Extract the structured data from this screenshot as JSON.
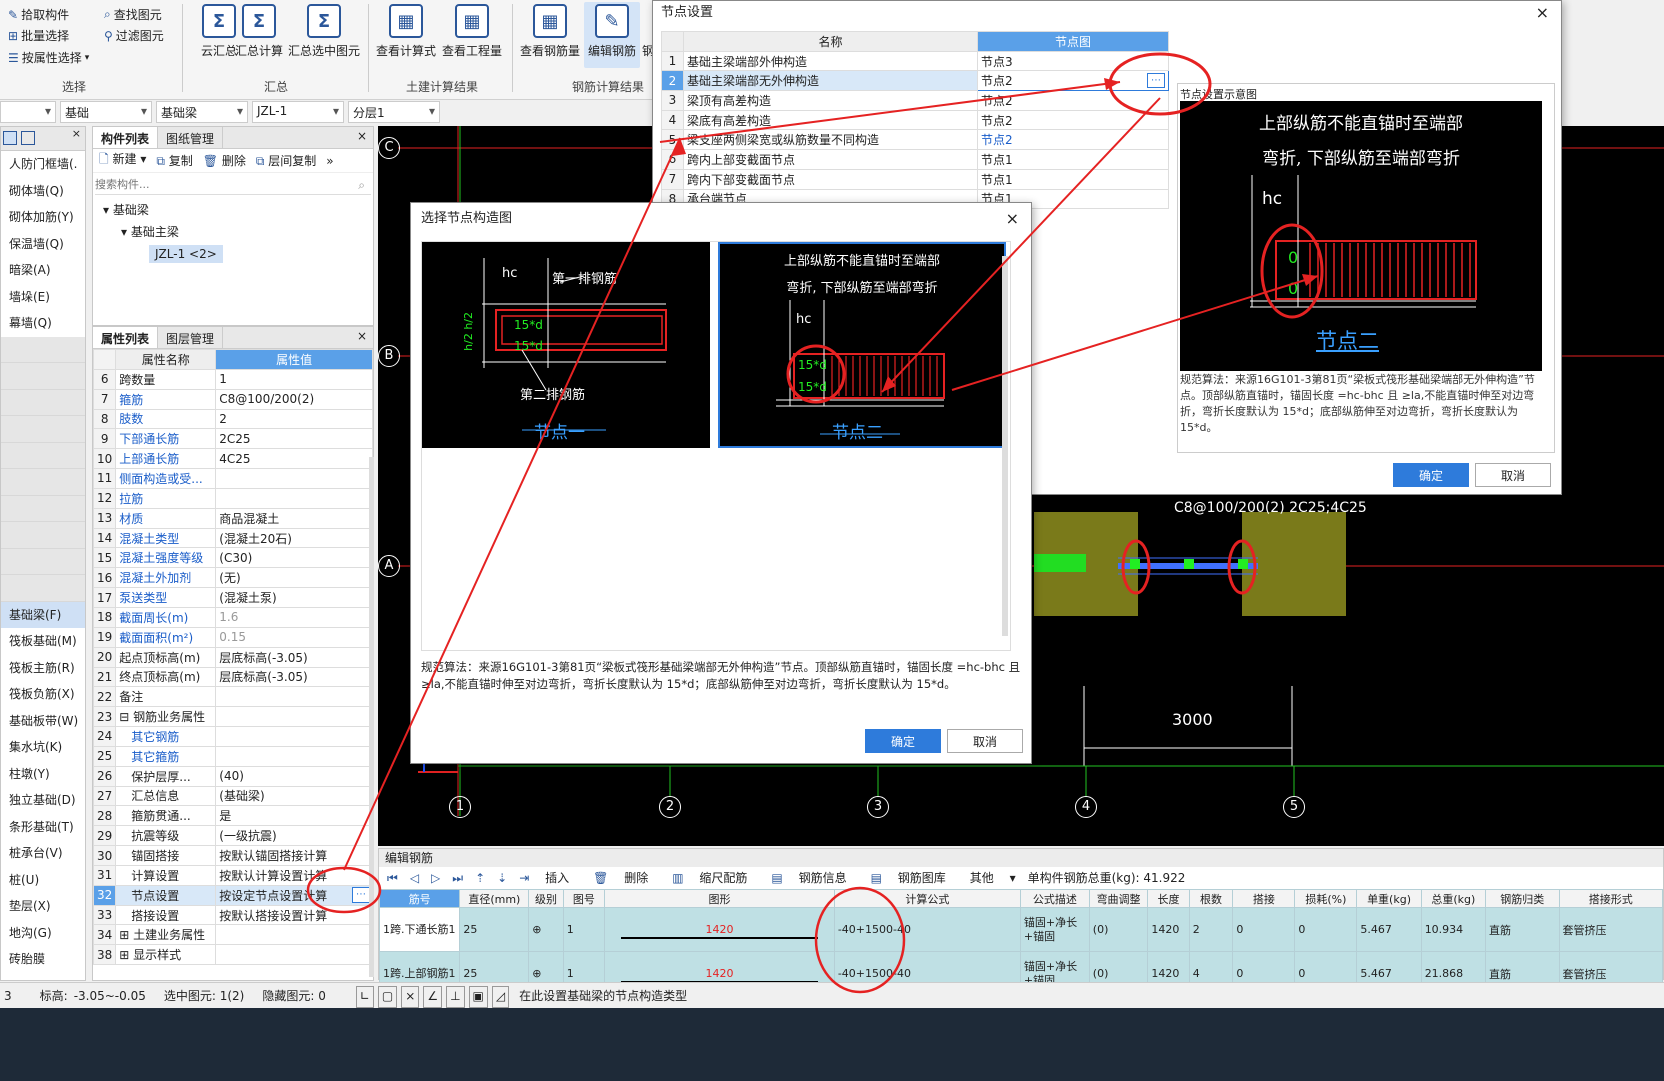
{
  "ribbon": {
    "select_group": {
      "pick": "拾取构件",
      "batch": "批量选择",
      "by_attr": "按属性选择",
      "find": "查找图元",
      "filter": "过滤图元",
      "label": "选择"
    },
    "summary_group": {
      "cloud": "云汇总",
      "calc": "汇总计算",
      "calc_sel": "汇总选中图元",
      "label": "汇总"
    },
    "civil_group": {
      "view_formula": "查看计算式",
      "view_qty": "查看工程量",
      "label": "土建计算结果"
    },
    "rebar_group": {
      "view_rebar": "查看钢筋量",
      "edit_rebar": "编辑钢筋",
      "extra": "钢",
      "label": "钢筋计算结果"
    }
  },
  "selectors": {
    "s0": "",
    "s1": "基础",
    "s2": "基础梁",
    "s3": "JZL-1",
    "s4": "分层1"
  },
  "left_nav": [
    "人防门框墙(.",
    "砌体墙(Q)",
    "砌体加筋(Y)",
    "保温墙(Q)",
    "暗梁(A)",
    "墙垛(E)",
    "幕墙(Q)",
    "",
    "",
    "",
    "",
    "",
    "",
    "",
    "",
    "",
    "",
    "基础梁(F)",
    "筏板基础(M)",
    "筏板主筋(R)",
    "筏板负筋(X)",
    "基础板带(W)",
    "集水坑(K)",
    "柱墩(Y)",
    "独立基础(D)",
    "条形基础(T)",
    "桩承台(V)",
    "桩(U)",
    "垫层(X)",
    "地沟(G)",
    "砖胎膜"
  ],
  "component_panel": {
    "tab1": "构件列表",
    "tab2": "图纸管理",
    "new": "新建",
    "copy": "复制",
    "delete": "删除",
    "floor_copy": "层间复制",
    "search_placeholder": "搜索构件...",
    "tree_root": "基础梁",
    "tree_child": "基础主梁",
    "tree_leaf": "JZL-1 <2>"
  },
  "property_panel": {
    "tab1": "属性列表",
    "tab2": "图层管理",
    "col_name": "属性名称",
    "col_value": "属性值",
    "rows": [
      {
        "n": "6",
        "name": "跨数量",
        "val": "1",
        "blue": false,
        "gray": false
      },
      {
        "n": "7",
        "name": "箍筋",
        "val": "C8@100/200(2)",
        "blue": true,
        "gray": false
      },
      {
        "n": "8",
        "name": "肢数",
        "val": "2",
        "blue": true,
        "gray": false
      },
      {
        "n": "9",
        "name": "下部通长筋",
        "val": "2C25",
        "blue": true,
        "gray": false
      },
      {
        "n": "10",
        "name": "上部通长筋",
        "val": "4C25",
        "blue": true,
        "gray": false
      },
      {
        "n": "11",
        "name": "侧面构造或受...",
        "val": "",
        "blue": true,
        "gray": false
      },
      {
        "n": "12",
        "name": "拉筋",
        "val": "",
        "blue": true,
        "gray": false
      },
      {
        "n": "13",
        "name": "材质",
        "val": "商品混凝土",
        "blue": true,
        "gray": false
      },
      {
        "n": "14",
        "name": "混凝土类型",
        "val": "(混凝土20石)",
        "blue": true,
        "gray": false
      },
      {
        "n": "15",
        "name": "混凝土强度等级",
        "val": "(C30)",
        "blue": true,
        "gray": false
      },
      {
        "n": "16",
        "name": "混凝土外加剂",
        "val": "(无)",
        "blue": true,
        "gray": false
      },
      {
        "n": "17",
        "name": "泵送类型",
        "val": "(混凝土泵)",
        "blue": true,
        "gray": false
      },
      {
        "n": "18",
        "name": "截面周长(m)",
        "val": "1.6",
        "blue": true,
        "gray": true
      },
      {
        "n": "19",
        "name": "截面面积(m²)",
        "val": "0.15",
        "blue": true,
        "gray": true
      },
      {
        "n": "20",
        "name": "起点顶标高(m)",
        "val": "层底标高(-3.05)",
        "blue": false,
        "gray": false
      },
      {
        "n": "21",
        "name": "终点顶标高(m)",
        "val": "层底标高(-3.05)",
        "blue": false,
        "gray": false
      },
      {
        "n": "22",
        "name": "备注",
        "val": "",
        "blue": false,
        "gray": false
      },
      {
        "n": "23",
        "name": "⊟ 钢筋业务属性",
        "val": "",
        "blue": false,
        "gray": false
      },
      {
        "n": "24",
        "name": "　其它钢筋",
        "val": "",
        "blue": true,
        "gray": false
      },
      {
        "n": "25",
        "name": "　其它箍筋",
        "val": "",
        "blue": true,
        "gray": false
      },
      {
        "n": "26",
        "name": "　保护层厚...",
        "val": "(40)",
        "blue": false,
        "gray": false
      },
      {
        "n": "27",
        "name": "　汇总信息",
        "val": "(基础梁)",
        "blue": false,
        "gray": false
      },
      {
        "n": "28",
        "name": "　箍筋贯通...",
        "val": "是",
        "blue": false,
        "gray": false
      },
      {
        "n": "29",
        "name": "　抗震等级",
        "val": "(一级抗震)",
        "blue": false,
        "gray": false
      },
      {
        "n": "30",
        "name": "　锚固搭接",
        "val": "按默认锚固搭接计算",
        "blue": false,
        "gray": false
      },
      {
        "n": "31",
        "name": "　计算设置",
        "val": "按默认计算设置计算",
        "blue": false,
        "gray": false
      },
      {
        "n": "32",
        "name": "　节点设置",
        "val": "按设定节点设置计算",
        "blue": false,
        "gray": false
      },
      {
        "n": "33",
        "name": "　搭接设置",
        "val": "按默认搭接设置计算",
        "blue": false,
        "gray": false
      },
      {
        "n": "34",
        "name": "⊞ 土建业务属性",
        "val": "",
        "blue": false,
        "gray": false
      },
      {
        "n": "38",
        "name": "⊞ 显示样式",
        "val": "",
        "blue": false,
        "gray": false
      }
    ]
  },
  "cad": {
    "axis_rows": [
      "C",
      "B",
      "A"
    ],
    "axis_cols": [
      "1",
      "2",
      "3",
      "4",
      "5"
    ],
    "beam_label": "C8@100/200(2) 2C25;4C25",
    "dimension": "3000"
  },
  "node_settings_dialog": {
    "title": "节点设置",
    "col_name": "名称",
    "col_diagram": "节点图",
    "rows": [
      {
        "n": "1",
        "name": "基础主梁端部外伸构造",
        "val": "节点3"
      },
      {
        "n": "2",
        "name": "基础主梁端部无外伸构造",
        "val": "节点2"
      },
      {
        "n": "3",
        "name": "梁顶有高差构造",
        "val": "节点2"
      },
      {
        "n": "4",
        "name": "梁底有高差构造",
        "val": "节点2"
      },
      {
        "n": "5",
        "name": "梁支座两侧梁宽或纵筋数量不同构造",
        "val": "节点2"
      },
      {
        "n": "6",
        "name": "跨内上部变截面节点",
        "val": "节点1"
      },
      {
        "n": "7",
        "name": "跨内下部变截面节点",
        "val": "节点1"
      },
      {
        "n": "8",
        "name": "承台端节点",
        "val": "节点1"
      }
    ],
    "preview_title": "节点设置示意图",
    "preview_text1": "上部纵筋不能直锚时至端部",
    "preview_text2": "弯折, 下部纵筋至端部弯折",
    "preview_hc": "hc",
    "preview_zero": "0",
    "preview_node": "节点二",
    "desc": "规范算法：来源16G101-3第81页“梁板式筏形基础梁端部无外伸构造”节点。顶部纵筋直锚时，锚固长度 =hc-bhc 且 ≥la,不能直锚时伸至对边弯折，弯折长度默认为 15*d；底部纵筋伸至对边弯折，弯折长度默认为 15*d。",
    "ok": "确定",
    "cancel": "取消"
  },
  "select_node_dialog": {
    "title": "选择节点构造图",
    "node1": {
      "hc": "hc",
      "row1": "第一排钢筋",
      "row2": "第二排钢筋",
      "side": "h/2 h/2",
      "d1": "15*d",
      "d2": "15*d",
      "name": "节点一"
    },
    "node2": {
      "line1": "上部纵筋不能直锚时至端部",
      "line2": "弯折, 下部纵筋至端部弯折",
      "hc": "hc",
      "d1": "15*d",
      "d2": "15*d",
      "name": "节点二"
    },
    "desc": "规范算法：来源16G101-3第81页“梁板式筏形基础梁端部无外伸构造”节点。顶部纵筋直锚时，锚固长度 =hc-bhc 且 ≥la,不能直锚时伸至对边弯折，弯折长度默认为 15*d；底部纵筋伸至对边弯折，弯折长度默认为 15*d。",
    "ok": "确定",
    "cancel": "取消"
  },
  "edit_rebar": {
    "title": "编辑钢筋",
    "insert": "插入",
    "delete": "删除",
    "scale": "缩尺配筋",
    "info": "钢筋信息",
    "lib": "钢筋图库",
    "other": "其他",
    "total": "单构件钢筋总重(kg): 41.922",
    "headers": [
      "筋号",
      "直径(mm)",
      "级别",
      "图号",
      "图形",
      "计算公式",
      "公式描述",
      "弯曲调整",
      "长度",
      "根数",
      "搭接",
      "损耗(%)",
      "单重(kg)",
      "总重(kg)",
      "钢筋归类",
      "搭接形式"
    ],
    "rows": [
      {
        "idx": "1",
        "no": "1跨.下通长筋1",
        "dia": "25",
        "grade": "⊕",
        "fig": "1",
        "shape": "1420",
        "formula": "-40+1500-40",
        "desc": "锚固+净长+锚固",
        "bend": "(0)",
        "len": "1420",
        "count": "2",
        "lap": "0",
        "loss": "0",
        "unit": "5.467",
        "total": "10.934",
        "cat": "直筋",
        "lap_type": "套管挤压"
      },
      {
        "idx": "2",
        "no": "1跨.上部钢筋1",
        "dia": "25",
        "grade": "⊕",
        "fig": "1",
        "shape": "1420",
        "formula": "-40+1500-40",
        "desc": "锚固+净长+锚固",
        "bend": "(0)",
        "len": "1420",
        "count": "4",
        "lap": "0",
        "loss": "0",
        "unit": "5.467",
        "total": "21.868",
        "cat": "直筋",
        "lap_type": "套管挤压"
      }
    ]
  },
  "status": {
    "floor": "3",
    "elev": "标高:",
    "elev_val": "-3.05~-0.05",
    "selected": "选中图元: 1(2)",
    "hidden": "隐藏图元: 0",
    "hint": "在此设置基础梁的节点构造类型"
  },
  "colors": {
    "annotation": "#e52222",
    "accent": "#2e7bdb",
    "header_blue": "#5aa0e8"
  }
}
